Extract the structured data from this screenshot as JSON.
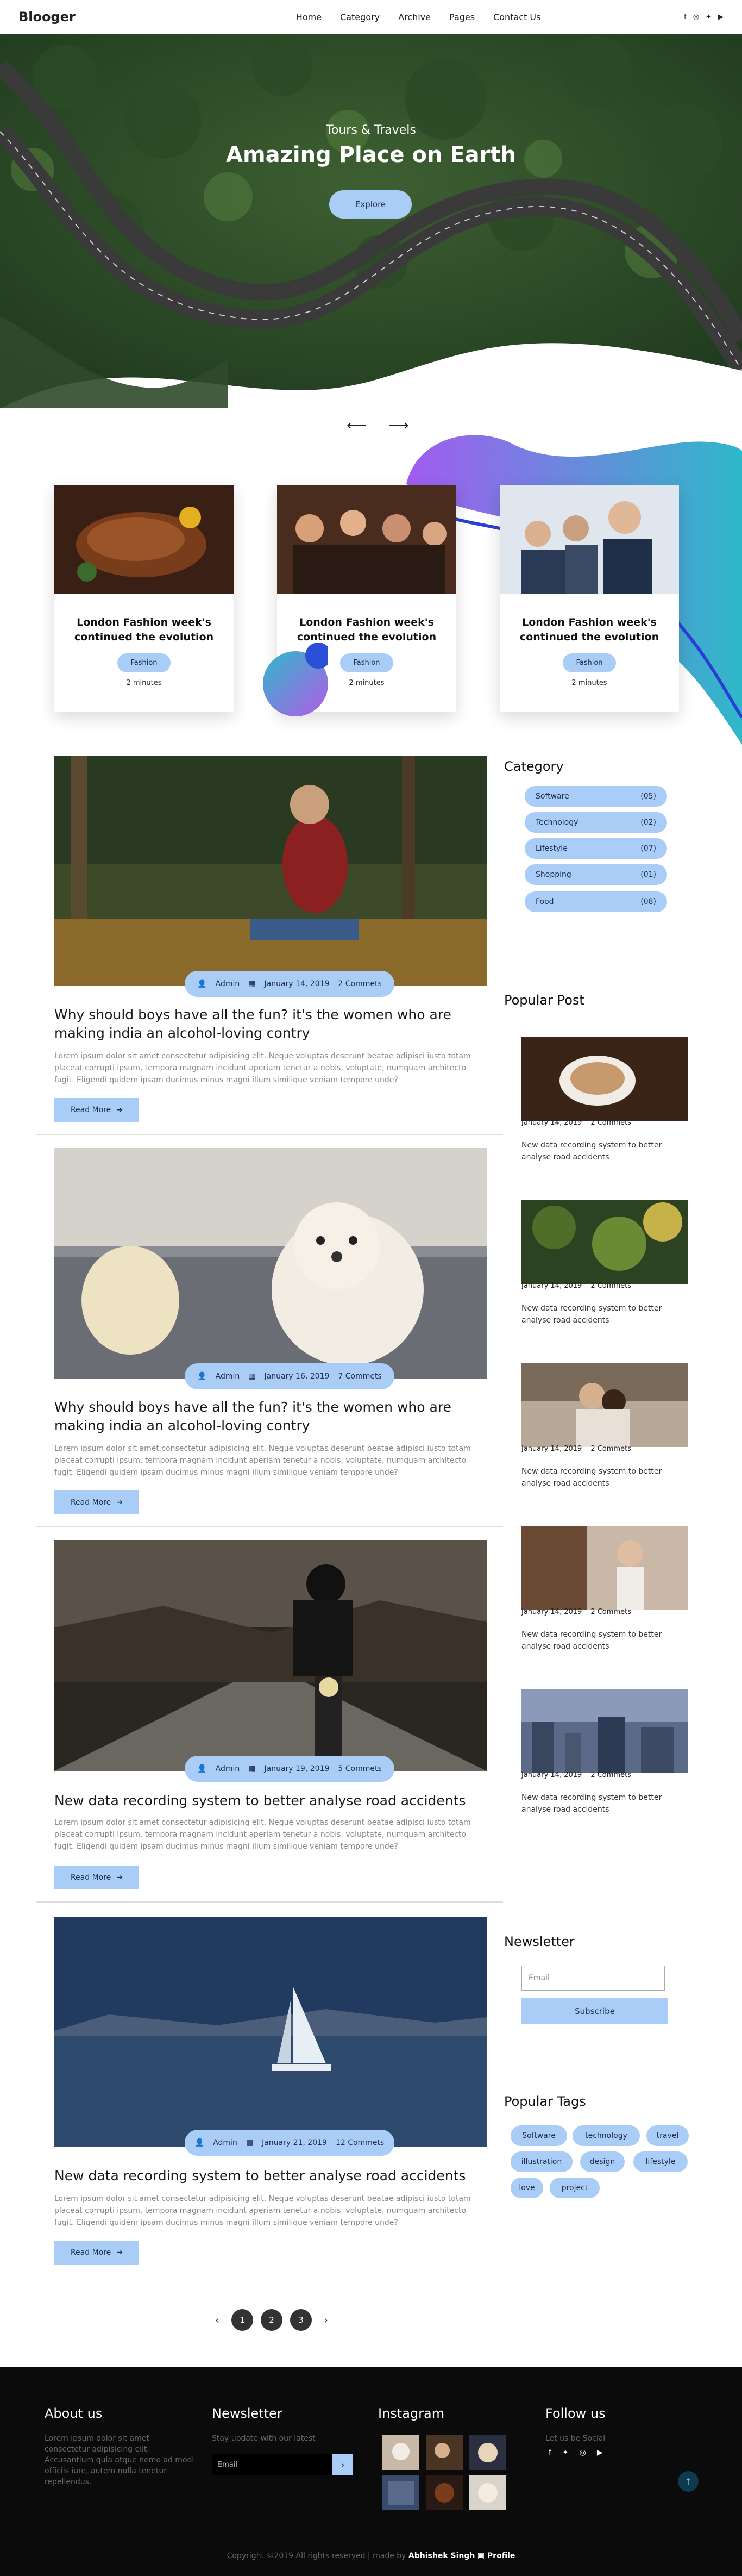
{
  "nav": {
    "logo": "Blooger",
    "menu": [
      "Home",
      "Category",
      "Archive",
      "Pages",
      "Contact Us"
    ],
    "social_icons": [
      "facebook-icon",
      "instagram-icon",
      "twitter-icon",
      "youtube-icon"
    ]
  },
  "hero": {
    "subtitle": "Tours & Travels",
    "title": "Amazing Place on Earth",
    "button": "Explore"
  },
  "slider": {
    "prev": "⟵",
    "next": "⟶"
  },
  "cards": [
    {
      "title": "London Fashion week's continued the evolution",
      "tag": "Fashion",
      "time": "2 minutes"
    },
    {
      "title": "London Fashion week's continued the evolution",
      "tag": "Fashion",
      "time": "2 minutes"
    },
    {
      "title": "London Fashion week's continued the evolution",
      "tag": "Fashion",
      "time": "2 minutes"
    }
  ],
  "posts": [
    {
      "author": "Admin",
      "date": "January 14, 2019",
      "comments": "2 Commets",
      "title": "Why should boys have all the fun? it's the women who are making india an alcohol-loving contry",
      "body": "Lorem ipsum dolor sit amet consectetur adipisicing elit. Neque voluptas deserunt beatae adipisci iusto totam placeat corrupti ipsum, tempora magnam incidunt aperiam tenetur a nobis, voluptate, numquam architecto fugit. Eligendi quidem ipsam ducimus minus magni illum similique veniam tempore unde?",
      "button": "Read More"
    },
    {
      "author": "Admin",
      "date": "January 16, 2019",
      "comments": "7 Commets",
      "title": "Why should boys have all the fun? it's the women who are making india an alcohol-loving contry",
      "body": "Lorem ipsum dolor sit amet consectetur adipisicing elit. Neque voluptas deserunt beatae adipisci iusto totam placeat corrupti ipsum, tempora magnam incidunt aperiam tenetur a nobis, voluptate, numquam architecto fugit. Eligendi quidem ipsam ducimus minus magni illum similique veniam tempore unde?",
      "button": "Read More"
    },
    {
      "author": "Admin",
      "date": "January 19, 2019",
      "comments": "5 Commets",
      "title": "New data recording system to better analyse road accidents",
      "body": "Lorem ipsum dolor sit amet consectetur adipisicing elit. Neque voluptas deserunt beatae adipisci iusto totam placeat corrupti ipsum, tempora magnam incidunt aperiam tenetur a nobis, voluptate, numquam architecto fugit. Eligendi quidem ipsam ducimus minus magni illum similique veniam tempore unde?",
      "button": "Read More"
    },
    {
      "author": "Admin",
      "date": "January 21, 2019",
      "comments": "12 Commets",
      "title": "New data recording system to better analyse road accidents",
      "body": "Lorem ipsum dolor sit amet consectetur adipisicing elit. Neque voluptas deserunt beatae adipisci iusto totam placeat corrupti ipsum, tempora magnam incidunt aperiam tenetur a nobis, voluptate, numquam architecto fugit. Eligendi quidem ipsam ducimus minus magni illum similique veniam tempore unde?",
      "button": "Read More"
    }
  ],
  "sidebar": {
    "category_heading": "Category",
    "categories": [
      {
        "name": "Software",
        "count": "(05)"
      },
      {
        "name": "Technology",
        "count": "(02)"
      },
      {
        "name": "Lifestyle",
        "count": "(07)"
      },
      {
        "name": "Shopping",
        "count": "(01)"
      },
      {
        "name": "Food",
        "count": "(08)"
      }
    ],
    "popular_heading": "Popular Post",
    "popular": [
      {
        "date": "January 14, 2019",
        "comments": "2 Commets",
        "text": "New data recording system to better analyse road accidents"
      },
      {
        "date": "January 14, 2019",
        "comments": "2 Commets",
        "text": "New data recording system to better analyse road accidents"
      },
      {
        "date": "January 14, 2019",
        "comments": "2 Commets",
        "text": "New data recording system to better analyse road accidents"
      },
      {
        "date": "January 14, 2019",
        "comments": "2 Commets",
        "text": "New data recording system to better analyse road accidents"
      },
      {
        "date": "January 14, 2019",
        "comments": "2 Commets",
        "text": "New data recording system to better analyse road accidents"
      }
    ],
    "newsletter_heading": "Newsletter",
    "newsletter_placeholder": "Email",
    "newsletter_button": "Subscribe",
    "tags_heading": "Popular Tags",
    "tags": [
      "Software",
      "technology",
      "travel",
      "illustration",
      "design",
      "lifestyle",
      "love",
      "project"
    ]
  },
  "pagination": {
    "prev": "‹",
    "pages": [
      "1",
      "2",
      "3"
    ],
    "next": "›"
  },
  "footer": {
    "about_heading": "About us",
    "about_text": "Lorem ipsum dolor sit amet consectetur adipisicing elit. Accusantium quia atque nemo ad modi officiis iure, autem nulla tenetur repellendus.",
    "newsletter_heading": "Newsletter",
    "newsletter_text": "Stay update with our latest",
    "email_placeholder": "Email",
    "instagram_heading": "Instagram",
    "follow_heading": "Follow us",
    "follow_text": "Let us be Social",
    "copyright_prefix": "Copyright ©2019 All rights reserved | made by",
    "copyright_author": "Abhishek Singh",
    "copyright_suffix": "Profile"
  }
}
